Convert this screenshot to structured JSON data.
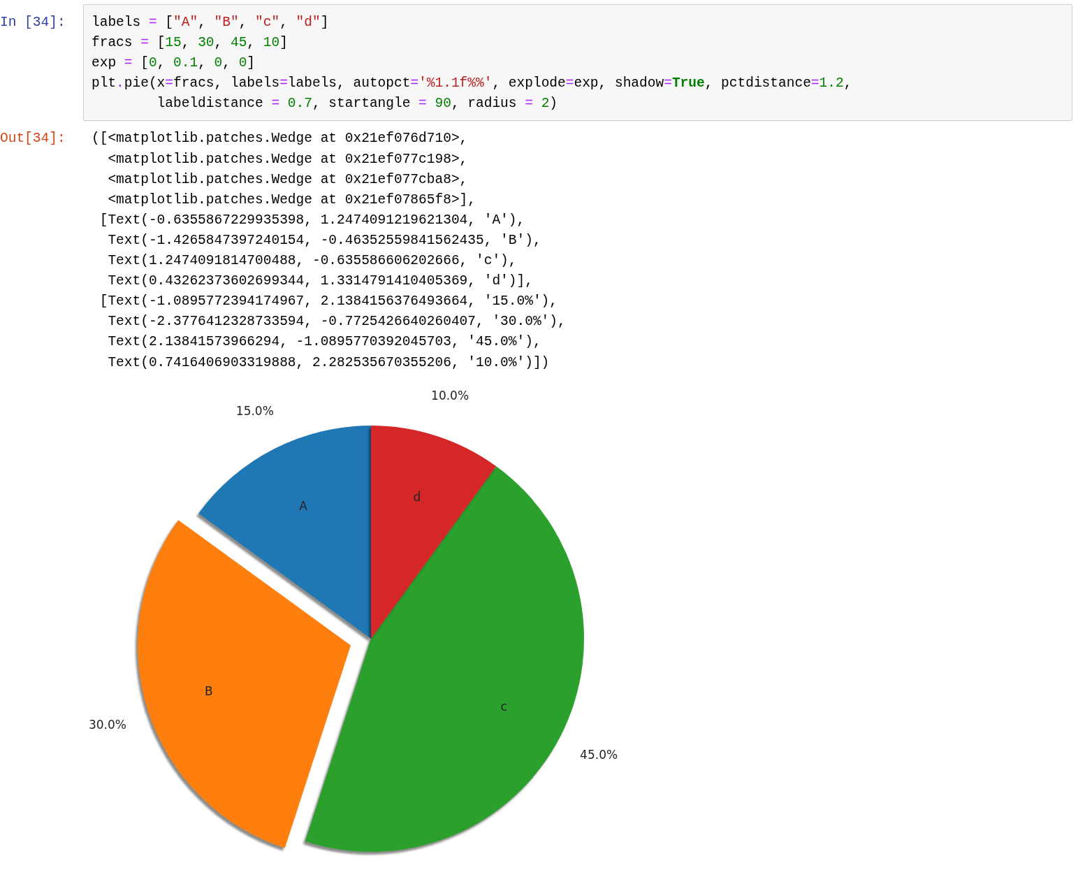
{
  "input_cell": {
    "prompt": "In [34]:",
    "lines": [
      [
        {
          "t": "labels ",
          "kind": "plain"
        },
        {
          "t": "= ",
          "kind": "operator"
        },
        {
          "t": "[",
          "kind": "plain"
        },
        {
          "t": "\"A\"",
          "kind": "string"
        },
        {
          "t": ", ",
          "kind": "plain"
        },
        {
          "t": "\"B\"",
          "kind": "string"
        },
        {
          "t": ", ",
          "kind": "plain"
        },
        {
          "t": "\"c\"",
          "kind": "string"
        },
        {
          "t": ", ",
          "kind": "plain"
        },
        {
          "t": "\"d\"",
          "kind": "string"
        },
        {
          "t": "]",
          "kind": "plain"
        }
      ],
      [
        {
          "t": "fracs ",
          "kind": "plain"
        },
        {
          "t": "= ",
          "kind": "operator"
        },
        {
          "t": "[",
          "kind": "plain"
        },
        {
          "t": "15",
          "kind": "number"
        },
        {
          "t": ", ",
          "kind": "plain"
        },
        {
          "t": "30",
          "kind": "number"
        },
        {
          "t": ", ",
          "kind": "plain"
        },
        {
          "t": "45",
          "kind": "number"
        },
        {
          "t": ", ",
          "kind": "plain"
        },
        {
          "t": "10",
          "kind": "number"
        },
        {
          "t": "]",
          "kind": "plain"
        }
      ],
      [
        {
          "t": "exp ",
          "kind": "plain"
        },
        {
          "t": "= ",
          "kind": "operator"
        },
        {
          "t": "[",
          "kind": "plain"
        },
        {
          "t": "0",
          "kind": "number"
        },
        {
          "t": ", ",
          "kind": "plain"
        },
        {
          "t": "0.1",
          "kind": "number"
        },
        {
          "t": ", ",
          "kind": "plain"
        },
        {
          "t": "0",
          "kind": "number"
        },
        {
          "t": ", ",
          "kind": "plain"
        },
        {
          "t": "0",
          "kind": "number"
        },
        {
          "t": "]",
          "kind": "plain"
        }
      ],
      [
        {
          "t": "plt",
          "kind": "plain"
        },
        {
          "t": ".",
          "kind": "operator"
        },
        {
          "t": "pie(x",
          "kind": "plain"
        },
        {
          "t": "=",
          "kind": "operator"
        },
        {
          "t": "fracs, labels",
          "kind": "plain"
        },
        {
          "t": "=",
          "kind": "operator"
        },
        {
          "t": "labels, autopct",
          "kind": "plain"
        },
        {
          "t": "=",
          "kind": "operator"
        },
        {
          "t": "'%1.1f%%'",
          "kind": "string"
        },
        {
          "t": ", explode",
          "kind": "plain"
        },
        {
          "t": "=",
          "kind": "operator"
        },
        {
          "t": "exp, shadow",
          "kind": "plain"
        },
        {
          "t": "=",
          "kind": "operator"
        },
        {
          "t": "True",
          "kind": "keyword"
        },
        {
          "t": ", pctdistance",
          "kind": "plain"
        },
        {
          "t": "=",
          "kind": "operator"
        },
        {
          "t": "1.2",
          "kind": "number"
        },
        {
          "t": ",",
          "kind": "plain"
        }
      ],
      [
        {
          "t": "        labeldistance ",
          "kind": "plain"
        },
        {
          "t": "= ",
          "kind": "operator"
        },
        {
          "t": "0.7",
          "kind": "number"
        },
        {
          "t": ", startangle ",
          "kind": "plain"
        },
        {
          "t": "= ",
          "kind": "operator"
        },
        {
          "t": "90",
          "kind": "number"
        },
        {
          "t": ", radius ",
          "kind": "plain"
        },
        {
          "t": "= ",
          "kind": "operator"
        },
        {
          "t": "2",
          "kind": "number"
        },
        {
          "t": ")",
          "kind": "plain"
        }
      ]
    ]
  },
  "output_cell": {
    "prompt": "Out[34]:",
    "lines": [
      "([<matplotlib.patches.Wedge at 0x21ef076d710>,",
      "  <matplotlib.patches.Wedge at 0x21ef077c198>,",
      "  <matplotlib.patches.Wedge at 0x21ef077cba8>,",
      "  <matplotlib.patches.Wedge at 0x21ef07865f8>],",
      " [Text(-0.6355867229935398, 1.2474091219621304, 'A'),",
      "  Text(-1.4265847397240154, -0.46352559841562435, 'B'),",
      "  Text(1.2474091814700488, -0.635586606202666, 'c'),",
      "  Text(0.43262373602699344, 1.3314791410405369, 'd')],",
      " [Text(-1.0895772394174967, 2.1384156376493664, '15.0%'),",
      "  Text(-2.3776412328733594, -0.7725426640260407, '30.0%'),",
      "  Text(2.13841573966294, -1.0895770392045703, '45.0%'),",
      "  Text(0.7416406903319888, 2.282535670355206, '10.0%')])"
    ],
    "chart_data": {
      "type": "pie",
      "categories": [
        "A",
        "B",
        "c",
        "d"
      ],
      "series": [
        {
          "values": [
            15,
            30,
            45,
            10
          ],
          "colors": [
            "#1f77b4",
            "#ff7f0e",
            "#2ca02c",
            "#d62728"
          ]
        }
      ],
      "value_labels": [
        "15.0%",
        "30.0%",
        "45.0%",
        "10.0%"
      ]
    }
  }
}
